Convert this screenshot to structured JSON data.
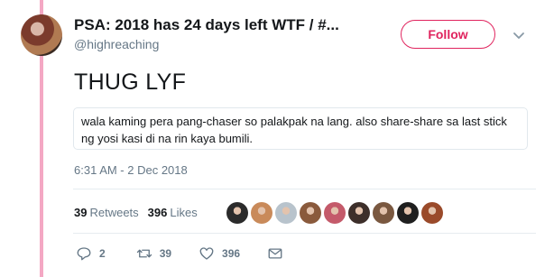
{
  "tweet": {
    "display_name": "PSA: 2018 has 24 days left WTF / #...",
    "handle": "@highreaching",
    "follow_label": "Follow",
    "text": "THUG LYF",
    "quoted_text": "wala kaming pera pang-chaser so palakpak na lang. also share-share sa last stick ng yosi kasi di na rin kaya bumili.",
    "timestamp": "6:31 AM - 2 Dec 2018",
    "retweets_count": "39",
    "retweets_label": "Retweets",
    "likes_count": "396",
    "likes_label": "Likes"
  },
  "actions": {
    "reply_count": "2",
    "retweet_count": "39",
    "like_count": "396"
  },
  "colors": {
    "accent": "#e0245e",
    "thread_line": "#f4a8c4",
    "muted": "#657786"
  },
  "likers": [
    {
      "name": "liker-avatar-1",
      "color": "#2b2b2b"
    },
    {
      "name": "liker-avatar-2",
      "color": "#c98a5a"
    },
    {
      "name": "liker-avatar-3",
      "color": "#b8c3cc"
    },
    {
      "name": "liker-avatar-4",
      "color": "#8a5a3c"
    },
    {
      "name": "liker-avatar-5",
      "color": "#c45a6a"
    },
    {
      "name": "liker-avatar-6",
      "color": "#3d2f2a"
    },
    {
      "name": "liker-avatar-7",
      "color": "#7a5840"
    },
    {
      "name": "liker-avatar-8",
      "color": "#1f1f1f"
    },
    {
      "name": "liker-avatar-9",
      "color": "#9a4a2a"
    }
  ]
}
